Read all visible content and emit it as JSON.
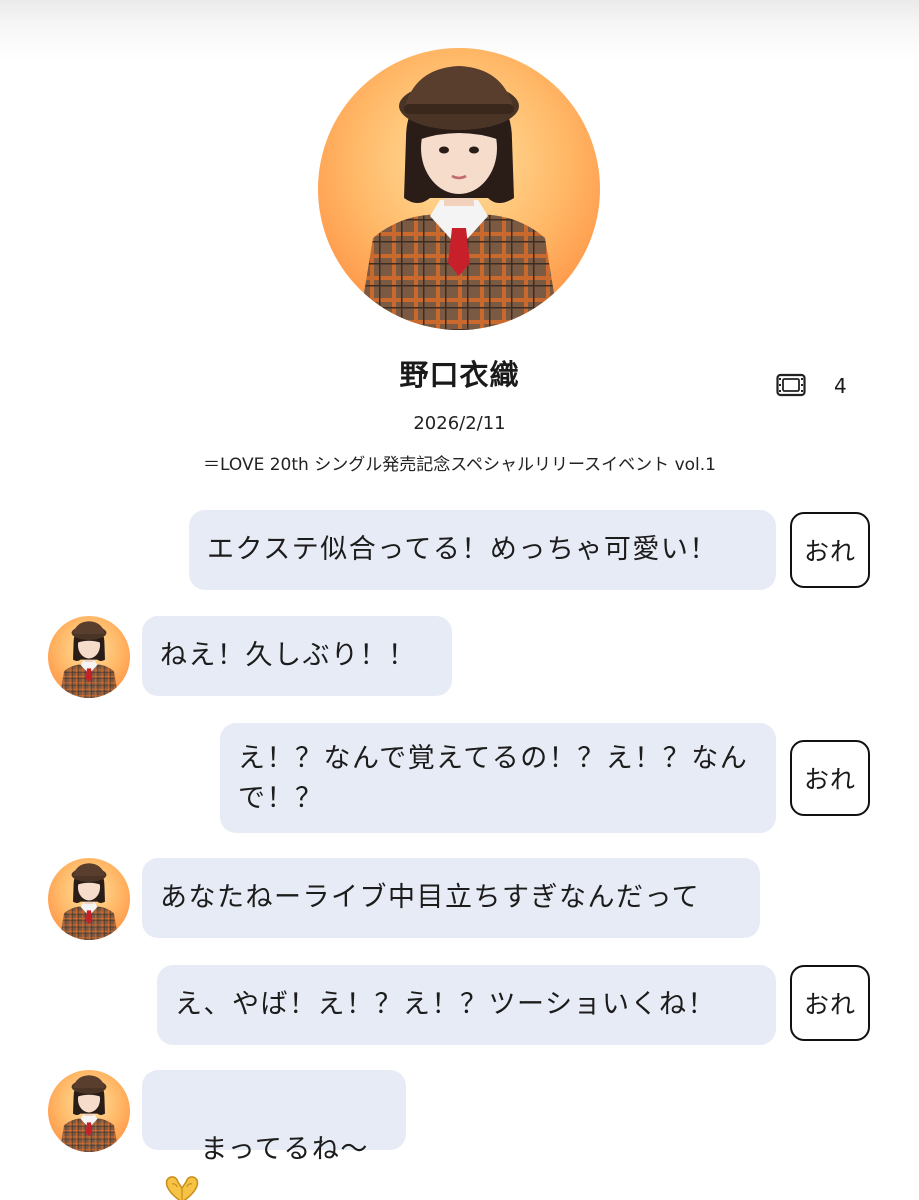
{
  "profile": {
    "name": "野口衣織",
    "ticket_count": "4",
    "date": "2026/2/11",
    "event": "＝LOVE 20th シングル発売記念スペシャルリリースイベント vol.1"
  },
  "messages": [
    {
      "from": "self",
      "text": "エクステ似合ってる！めっちゃ可愛い！",
      "tag": "おれ"
    },
    {
      "from": "idol",
      "text": "ねえ！久しぶり！！"
    },
    {
      "from": "self",
      "text": "え！？なんで覚えてるの！？え！？なんで！？",
      "tag": "おれ"
    },
    {
      "from": "idol",
      "text": "あなたねーライブ中目立ちすぎなんだって"
    },
    {
      "from": "self",
      "text": "え、やば！え！？え！？ツーショいくね！",
      "tag": "おれ"
    },
    {
      "from": "idol",
      "text": "まってるね〜",
      "emoji": "heart-hands-emoji"
    }
  ],
  "colors": {
    "bubble": "#e7ebf5",
    "avatar_bg_light": "#ffd27a",
    "avatar_bg_dark": "#ff8a3d",
    "plaid": "#8a5a3b"
  }
}
